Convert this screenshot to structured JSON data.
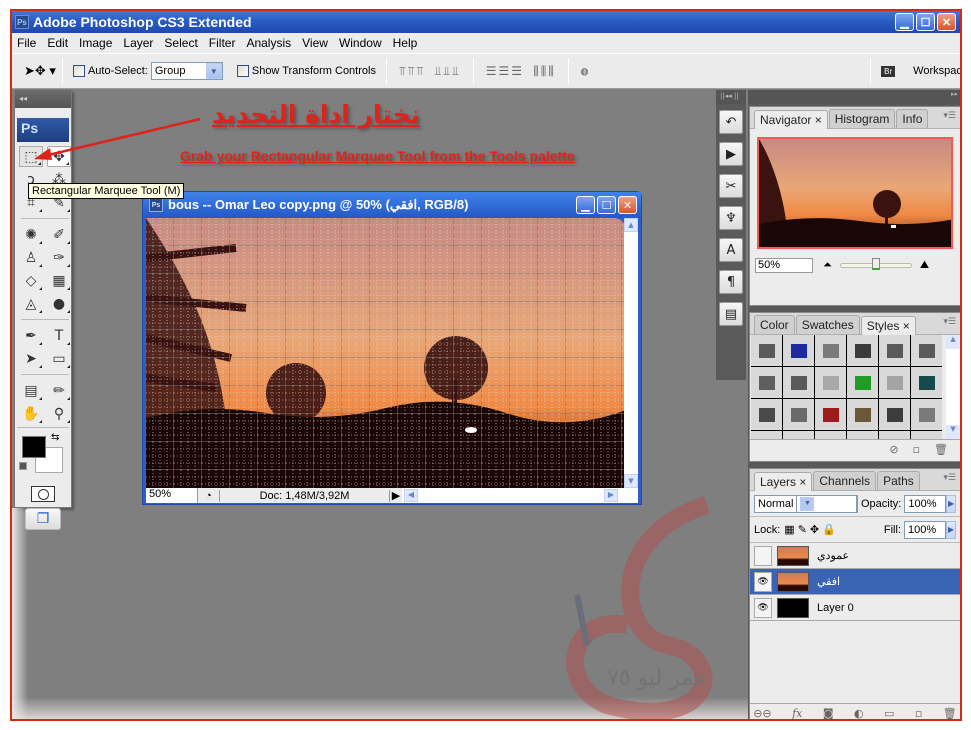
{
  "window": {
    "app_icon": "Ps",
    "title": "Adobe Photoshop CS3 Extended",
    "buttons": [
      "minimize",
      "maximize",
      "close"
    ]
  },
  "menu": [
    "File",
    "Edit",
    "Image",
    "Layer",
    "Select",
    "Filter",
    "Analysis",
    "View",
    "Window",
    "Help"
  ],
  "options_bar": {
    "tool_icon": "move-tool-icon",
    "auto_select_label": "Auto-Select:",
    "auto_select_checked": false,
    "auto_select_value": "Group",
    "show_transform_label": "Show Transform Controls",
    "show_transform_checked": false,
    "align_group_1": "align-top align-vcenter align-bottom align-left align-hcenter align-right",
    "distribute_group": "distribute-top distribute-vcenter distribute-bottom distribute-left distribute-hcenter distribute-right",
    "auto_align_icon": "auto-align-layers-icon",
    "bridge_icon": "Br",
    "workspace_label": "Workspace"
  },
  "tools_panel": {
    "logo": "Ps",
    "tools": [
      {
        "name": "rectangular-marquee",
        "glyph": "⬚"
      },
      {
        "name": "move",
        "glyph": "✥"
      },
      {
        "name": "lasso",
        "glyph": "ↄ"
      },
      {
        "name": "magic-wand",
        "glyph": "⁂"
      },
      {
        "name": "crop",
        "glyph": "⌗"
      },
      {
        "name": "slice",
        "glyph": "✎"
      },
      {
        "name": "healing-brush",
        "glyph": "✺"
      },
      {
        "name": "brush",
        "glyph": "✐"
      },
      {
        "name": "clone-stamp",
        "glyph": "♙"
      },
      {
        "name": "history-brush",
        "glyph": "✑"
      },
      {
        "name": "eraser",
        "glyph": "◇"
      },
      {
        "name": "gradient",
        "glyph": "▦"
      },
      {
        "name": "blur",
        "glyph": "◬"
      },
      {
        "name": "dodge",
        "glyph": "●"
      },
      {
        "name": "pen",
        "glyph": "✒"
      },
      {
        "name": "type",
        "glyph": "T"
      },
      {
        "name": "path-selection",
        "glyph": "➤"
      },
      {
        "name": "shape",
        "glyph": "▭"
      },
      {
        "name": "notes",
        "glyph": "▤"
      },
      {
        "name": "eyedropper",
        "glyph": "✏"
      },
      {
        "name": "hand",
        "glyph": "✋"
      },
      {
        "name": "zoom",
        "glyph": "⚲"
      }
    ],
    "foreground_color": "#000000",
    "background_color": "#ffffff"
  },
  "tooltip": "Rectangular Marquee Tool (M)",
  "annotation": {
    "arabic": "نختار اداة التحديد",
    "english": "Grab your Rectangular Marquee Tool from the Tools palette",
    "color": "#e0231a"
  },
  "document": {
    "title": "bous -- Omar Leo copy.png @ 50% (افقي, RGB/8)",
    "zoom": "50%",
    "doc_info": "Doc: 1,48M/3,92M"
  },
  "navigator": {
    "tabs": [
      "Navigator",
      "Histogram",
      "Info"
    ],
    "active_tab": "Navigator",
    "zoom": "50%",
    "zoom_slider_fraction": 0.48
  },
  "styles_panel": {
    "tabs": [
      "Color",
      "Swatches",
      "Styles"
    ],
    "active_tab": "Styles",
    "swatches": [
      "#5a5a5a",
      "#1e2aa0",
      "#7a7a7a",
      "#3a3a3a",
      "#5a5a5a",
      "#5a5a5a",
      "#5f5f5f",
      "#5a5a5a",
      "#a8a8a8",
      "#1f9b26",
      "#a4a4a4",
      "#134c4a",
      "#4a4a4a",
      "#6a6a6a",
      "#9c1c1c",
      "#6a5838",
      "#3c3c3c",
      "#7a7a7a",
      "#6a4a30",
      "#6c6c6c",
      "#8c9cb0",
      "#a4a4a4",
      "#6a5838",
      "#e2e2e2"
    ]
  },
  "layers_panel": {
    "tabs": [
      "Layers",
      "Channels",
      "Paths"
    ],
    "active_tab": "Layers",
    "blend_mode": "Normal",
    "opacity_label": "Opacity:",
    "opacity": "100%",
    "lock_label": "Lock:",
    "fill_label": "Fill:",
    "fill": "100%",
    "layers": [
      {
        "name": "عمودي",
        "visible": false,
        "selected": false,
        "thumb": "sunset"
      },
      {
        "name": "افقي",
        "visible": true,
        "selected": true,
        "thumb": "sunset"
      },
      {
        "name": "Layer 0",
        "visible": true,
        "selected": false,
        "thumb": "black"
      }
    ],
    "footer_icons": [
      "link-layers-icon",
      "fx-icon",
      "layer-mask-icon",
      "adjustment-layer-icon",
      "new-group-icon",
      "new-layer-icon",
      "delete-layer-icon"
    ]
  },
  "dock_icons": [
    "history-icon",
    "actions-icon",
    "tool-presets-icon",
    "brushes-icon",
    "character-icon",
    "paragraph-icon",
    "layer-comps-icon"
  ],
  "watermark": "عمر ليو ٧٥"
}
